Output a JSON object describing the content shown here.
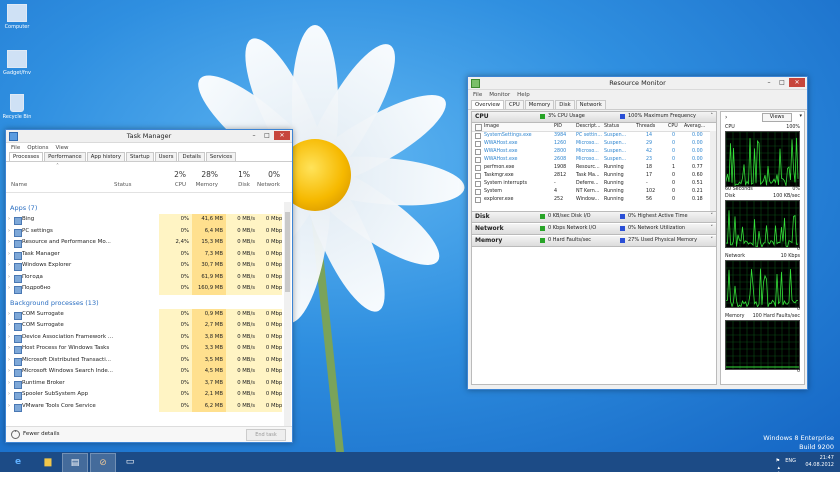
{
  "desktop": {
    "icons": [
      {
        "label": "Computer"
      },
      {
        "label": "Gadget/fnv"
      },
      {
        "label": "Recycle Bin"
      }
    ],
    "watermark": {
      "line1": "Windows 8 Enterprise",
      "line2": "Build 9200"
    }
  },
  "task_manager": {
    "title": "Task Manager",
    "menu": [
      "File",
      "Options",
      "View"
    ],
    "tabs": [
      "Processes",
      "Performance",
      "App history",
      "Startup",
      "Users",
      "Details",
      "Services"
    ],
    "active_tab": "Processes",
    "columns": {
      "name": "Name",
      "status": "Status",
      "cpu_pct": "2%",
      "cpu": "CPU",
      "mem_pct": "28%",
      "mem": "Memory",
      "disk_pct": "1%",
      "disk": "Disk",
      "net_pct": "0%",
      "net": "Network"
    },
    "apps_group": "Apps (7)",
    "apps": [
      {
        "name": "Bing",
        "cpu": "0%",
        "mem": "41,6 MB",
        "disk": "0 MB/s",
        "net": "0 Mbps"
      },
      {
        "name": "PC settings",
        "cpu": "0%",
        "mem": "6,4 MB",
        "disk": "0 MB/s",
        "net": "0 Mbps"
      },
      {
        "name": "Resource and Performance Mo...",
        "cpu": "2,4%",
        "mem": "15,3 MB",
        "disk": "0 MB/s",
        "net": "0 Mbps"
      },
      {
        "name": "Task Manager",
        "cpu": "0%",
        "mem": "7,3 MB",
        "disk": "0 MB/s",
        "net": "0 Mbps"
      },
      {
        "name": "Windows Explorer",
        "cpu": "0%",
        "mem": "30,7 MB",
        "disk": "0 MB/s",
        "net": "0 Mbps"
      },
      {
        "name": "Погода",
        "cpu": "0%",
        "mem": "61,9 MB",
        "disk": "0 MB/s",
        "net": "0 Mbps"
      },
      {
        "name": "Подробно",
        "cpu": "0%",
        "mem": "160,9 MB",
        "disk": "0 MB/s",
        "net": "0 Mbps"
      }
    ],
    "bg_group": "Background processes (13)",
    "bg": [
      {
        "name": "COM Surrogate",
        "cpu": "0%",
        "mem": "0,9 MB",
        "disk": "0 MB/s",
        "net": "0 Mbps"
      },
      {
        "name": "COM Surrogate",
        "cpu": "0%",
        "mem": "2,7 MB",
        "disk": "0 MB/s",
        "net": "0 Mbps"
      },
      {
        "name": "Device Association Framework ...",
        "cpu": "0%",
        "mem": "3,8 MB",
        "disk": "0 MB/s",
        "net": "0 Mbps"
      },
      {
        "name": "Host Process for Windows Tasks",
        "cpu": "0%",
        "mem": "3,3 MB",
        "disk": "0 MB/s",
        "net": "0 Mbps"
      },
      {
        "name": "Microsoft Distributed Transacti...",
        "cpu": "0%",
        "mem": "3,5 MB",
        "disk": "0 MB/s",
        "net": "0 Mbps"
      },
      {
        "name": "Microsoft Windows Search Inde...",
        "cpu": "0%",
        "mem": "4,5 MB",
        "disk": "0 MB/s",
        "net": "0 Mbps"
      },
      {
        "name": "Runtime Broker",
        "cpu": "0%",
        "mem": "3,7 MB",
        "disk": "0 MB/s",
        "net": "0 Mbps"
      },
      {
        "name": "Spooler SubSystem App",
        "cpu": "0%",
        "mem": "2,1 MB",
        "disk": "0 MB/s",
        "net": "0 Mbps"
      },
      {
        "name": "VMware Tools Core Service",
        "cpu": "0%",
        "mem": "6,2 MB",
        "disk": "0 MB/s",
        "net": "0 Mbps"
      }
    ],
    "fewer_details": "Fewer details",
    "end_task": "End task"
  },
  "resource_monitor": {
    "title": "Resource Monitor",
    "menu": [
      "File",
      "Monitor",
      "Help"
    ],
    "tabs": [
      "Overview",
      "CPU",
      "Memory",
      "Disk",
      "Network"
    ],
    "active_tab": "Overview",
    "cpu_section": {
      "label": "CPU",
      "usage": "3% CPU Usage",
      "freq": "100% Maximum Frequency"
    },
    "cpu_columns": [
      "Image",
      "PID",
      "Descript...",
      "Status",
      "Threads",
      "CPU",
      "Averag..."
    ],
    "cpu_rows": [
      {
        "image": "SystemSettings.exe",
        "pid": "3984",
        "desc": "PC settin...",
        "status": "Suspen...",
        "threads": "14",
        "cpu": "0",
        "avg": "0.00",
        "blue": true
      },
      {
        "image": "WWAHost.exe",
        "pid": "1260",
        "desc": "Microso...",
        "status": "Suspen...",
        "threads": "29",
        "cpu": "0",
        "avg": "0.00",
        "blue": true
      },
      {
        "image": "WWAHost.exe",
        "pid": "2800",
        "desc": "Microso...",
        "status": "Suspen...",
        "threads": "42",
        "cpu": "0",
        "avg": "0.00",
        "blue": true
      },
      {
        "image": "WWAHost.exe",
        "pid": "2608",
        "desc": "Microso...",
        "status": "Suspen...",
        "threads": "23",
        "cpu": "0",
        "avg": "0.00",
        "blue": true
      },
      {
        "image": "perfmon.exe",
        "pid": "1908",
        "desc": "Resourc...",
        "status": "Running",
        "threads": "18",
        "cpu": "1",
        "avg": "0.77",
        "blue": false
      },
      {
        "image": "Taskmgr.exe",
        "pid": "2812",
        "desc": "Task Ma...",
        "status": "Running",
        "threads": "17",
        "cpu": "0",
        "avg": "0.60",
        "blue": false
      },
      {
        "image": "System interrupts",
        "pid": "-",
        "desc": "Deferre...",
        "status": "Running",
        "threads": "-",
        "cpu": "0",
        "avg": "0.51",
        "blue": false
      },
      {
        "image": "System",
        "pid": "4",
        "desc": "NT Kern...",
        "status": "Running",
        "threads": "102",
        "cpu": "0",
        "avg": "0.21",
        "blue": false
      },
      {
        "image": "explorer.exe",
        "pid": "252",
        "desc": "Window...",
        "status": "Running",
        "threads": "56",
        "cpu": "0",
        "avg": "0.18",
        "blue": false
      }
    ],
    "disk_section": {
      "label": "Disk",
      "io": "0 KB/sec Disk I/O",
      "active": "0% Highest Active Time"
    },
    "net_section": {
      "label": "Network",
      "io": "0 Kbps Network I/O",
      "util": "0% Network Utilization"
    },
    "mem_section": {
      "label": "Memory",
      "faults": "0 Hard Faults/sec",
      "used": "27% Used Physical Memory"
    },
    "views_button": "Views",
    "graphs": {
      "cpu": {
        "label": "CPU",
        "max": "100%",
        "footer_left": "60 Seconds",
        "footer_right": "0%"
      },
      "disk": {
        "label": "Disk",
        "max": "100 KB/sec",
        "footer_right": "0"
      },
      "network": {
        "label": "Network",
        "max": "10 Kbps",
        "footer_right": "0"
      },
      "memory": {
        "label": "Memory",
        "max": "100 Hard Faults/sec",
        "footer_right": "0"
      }
    }
  },
  "taskbar": {
    "tray_lang": "ENG",
    "time": "21:47",
    "date": "04.08.2012"
  }
}
